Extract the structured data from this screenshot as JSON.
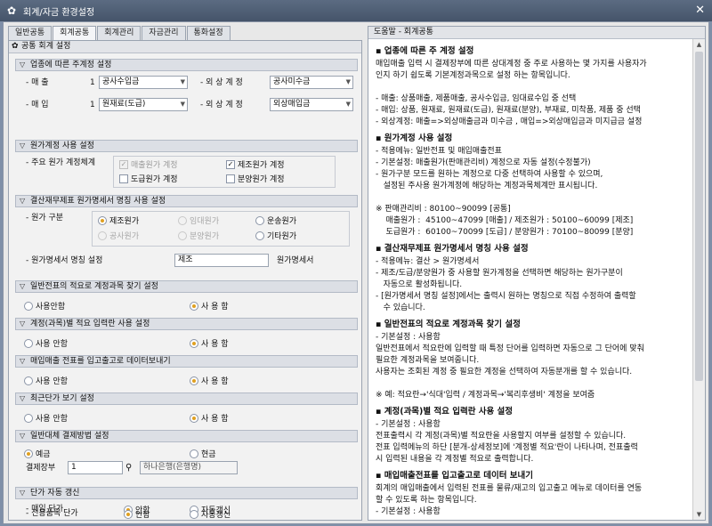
{
  "window": {
    "title": "회계/자금 환경설정",
    "icon": "gear-icon",
    "close": "✕"
  },
  "tabs": [
    "일반공통",
    "회계공통",
    "회계관리",
    "자금관리",
    "통화설정"
  ],
  "active_tab": 1,
  "left_header": "공통 회계 설정",
  "sections": {
    "industry": {
      "title": "업종에 따른 주계정 설정",
      "rows": [
        {
          "label1": "- 매     출",
          "num": "1",
          "combo1": "공사수입금",
          "label2": "- 외 상 계 정",
          "combo2": "공사미수금"
        },
        {
          "label1": "- 매     입",
          "num": "1",
          "combo1": "원재료(도급)",
          "label2": "- 외 상 계 정",
          "combo2": "외상매입금"
        }
      ]
    },
    "cost": {
      "title": "원가계정 사용 설정",
      "label": "- 주요 원가 계정체계",
      "checks": [
        {
          "label": "매출원가 계정",
          "checked": true,
          "disabled": true
        },
        {
          "label": "제조원가 계정",
          "checked": true,
          "disabled": false
        },
        {
          "label": "도급원가 계정",
          "checked": false,
          "disabled": false
        },
        {
          "label": "분양원가 계정",
          "checked": false,
          "disabled": false
        }
      ]
    },
    "statement": {
      "title": "결산재무제표 원가명세서 명칭 사용 설정",
      "label_type": "- 원가 구분",
      "radios": [
        {
          "label": "제조원가",
          "on": true,
          "disabled": false
        },
        {
          "label": "임대원가",
          "on": false,
          "disabled": true
        },
        {
          "label": "운송원가",
          "on": false,
          "disabled": false
        },
        {
          "label": "공사원가",
          "on": false,
          "disabled": true
        },
        {
          "label": "분양원가",
          "on": false,
          "disabled": true
        },
        {
          "label": "기타원가",
          "on": false,
          "disabled": false
        }
      ],
      "label_name": "- 원가명세서 명칭 설정",
      "name_value": "제조",
      "name_suffix": "원가명세서"
    },
    "s4": {
      "title": "일반전표의 적요로 계정과목 찾기 설정",
      "opt1": "사용안함",
      "opt2": "사 용 함",
      "sel": 2
    },
    "s5": {
      "title": "계정(과목)별 적요 입력란 사용 설정",
      "opt1": "사용 안함",
      "opt2": "사 용 함",
      "sel": 2
    },
    "s6": {
      "title": "매입매출 전표를 입고출고로 데이터보내기",
      "opt1": "사용 안함",
      "opt2": "사 용 함",
      "sel": 2
    },
    "s7": {
      "title": "최근단가 보기 설정",
      "opt1": "사용 안함",
      "opt2": "사 용 함",
      "sel": 2
    },
    "s8": {
      "title": "일반대체 결제방법 설정",
      "opt1": "예금",
      "opt2": "현금",
      "sel": 1,
      "account_label": "결제장부",
      "account_no": "1",
      "account_name": "하나은행(은행명)"
    },
    "s9": {
      "title": "단가 자동 갱신",
      "rows": [
        {
          "label": "- 매입 단가",
          "opt1": "안함",
          "opt2": "자동갱신",
          "sel": 1
        },
        {
          "label": "- 전용품목 단가",
          "opt1": "안함",
          "opt2": "자동갱신",
          "sel": 1
        }
      ]
    }
  },
  "help": {
    "header": "도움말 - 회계공통",
    "sections": [
      {
        "title": "▪ 업종에 따른 주 계정 설정",
        "lines": [
          "매입매출 입력 시 결제장부에 따른 상대계정 중 주로 사용하는 몇 가지를 사용자가",
          "인지 하기 쉽도록 기본계정과목으로 설정 하는 항목입니다.",
          "",
          "- 매출: 상품매출, 제품매출, 공사수입금, 임대료수입 중 선택",
          "- 매입: 상품, 원재료, 원재료(도급), 원재료(분양), 부재료, 미착품, 제품 중 선택",
          "- 외상계정: 매출=>외상매출금과 미수금 , 매입=>외상매입금과 미지급금 설정"
        ]
      },
      {
        "title": "▪ 원가계정 사용 설정",
        "lines": [
          "- 적용메뉴: 일반전표 및 매입매출전표",
          "- 기본설정: 매출원가(판매관리비) 계정으로 자동 설정(수정불가)",
          "- 원가구분 모드를 원하는 계정으로 다중 선택하여 사용할 수 있으며,",
          "   설정된 주사용 원가계정에 해당하는 계정과목체계만 표시됩니다.",
          "",
          "※ 판매관리비 : 80100~90099 [공통]",
          "    매출원가 :  45100~47099 [매출] / 제조원가 : 50100~60099 [제조]",
          "    도급원가 :  60100~70099 [도급] / 분양원가 : 70100~80099 [분양]"
        ]
      },
      {
        "title": "▪ 결산재무제표 원가명세서 명칭 사용 설정",
        "lines": [
          "- 적용메뉴: 결산 > 원가명세서",
          "- 제조/도급/분양원가 중 사용할 원가계정을 선택하면 해당하는 원가구분이",
          "   자동으로 활성화됩니다.",
          "- [원가명세서 명칭 설정]에서는 출력시 원하는 명칭으로 직접 수정하여 출력할",
          "   수 있습니다."
        ]
      },
      {
        "title": "▪ 일반전표의 적요로 계정과목 찾기 설정",
        "lines": [
          "- 기본설정 : 사용함",
          "일반전표에서 적요란에 입력할 때 특정 단어를 입력하면 자동으로 그 단어에 맞춰",
          "필요한 계정과목을 보여줍니다.",
          "사용자는 조회된 계정 중 필요한 계정을 선택하여 자동분개를 할 수 있습니다.",
          "",
          "※ 예: 적요란→'식대'입력 / 계정과목→'복리후생비' 계정을 보여줌"
        ]
      },
      {
        "title": "▪ 계정(과목)별 적요 입력란 사용 설정",
        "lines": [
          "- 기본설정 : 사용함",
          "전표출력시 각 계정(과목)별 적요란을 사용할지 여부를 설정할 수 있습니다.",
          "전표 입력메뉴의 하단 [분개-상세정보]에 '계정별 적요'란이 나타나며, 전표출력",
          "시 입력된 내용을 각 계정별 적요로 출력합니다."
        ]
      },
      {
        "title": "▪ 매입매출전표를 입고출고로 데이터 보내기",
        "lines": [
          "회계의 매입매출에서 입력된 전표를 물류/재고의 입고출고 메뉴로 데이터를 연동",
          "할 수 있도록 하는 항목입니다.",
          "- 기본설정 : 사용함"
        ]
      }
    ]
  }
}
